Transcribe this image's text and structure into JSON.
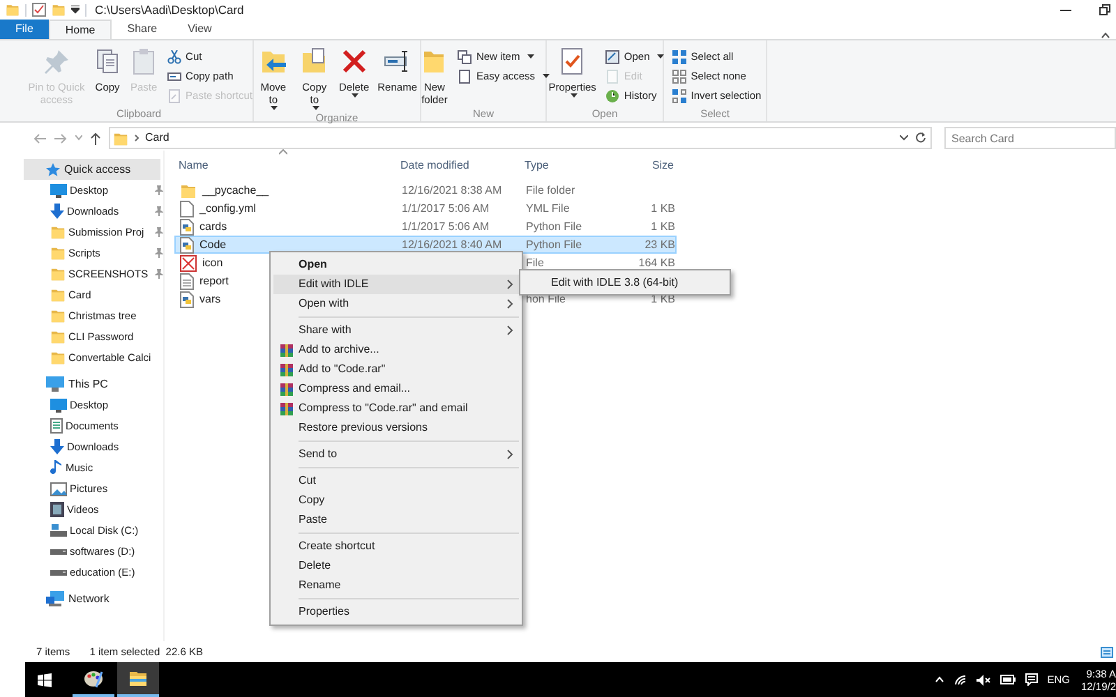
{
  "title_bar": {
    "path": "C:\\Users\\Aadi\\Desktop\\Card"
  },
  "tabs": [
    {
      "label": "File",
      "kind": "file",
      "selected": false
    },
    {
      "label": "Home",
      "kind": "tab",
      "selected": true
    },
    {
      "label": "Share",
      "kind": "tab",
      "selected": false
    },
    {
      "label": "View",
      "kind": "tab",
      "selected": false
    }
  ],
  "ribbon": [
    {
      "label": "Clipboard",
      "buttons": [
        {
          "label": "Pin to Quick access",
          "kind": "large",
          "disabled": true,
          "dropdown": false
        },
        {
          "label": "Copy",
          "kind": "large",
          "disabled": false,
          "dropdown": false
        },
        {
          "label": "Paste",
          "kind": "large",
          "disabled": true,
          "dropdown": false
        },
        {
          "label": "Cut",
          "kind": "small",
          "disabled": false,
          "dropdown": false
        },
        {
          "label": "Copy path",
          "kind": "small",
          "disabled": false,
          "dropdown": false
        },
        {
          "label": "Paste shortcut",
          "kind": "small",
          "disabled": true,
          "dropdown": false
        }
      ]
    },
    {
      "label": "Organize",
      "buttons": [
        {
          "label": "Move to",
          "kind": "large",
          "disabled": false,
          "dropdown": true
        },
        {
          "label": "Copy to",
          "kind": "large",
          "disabled": false,
          "dropdown": true
        },
        {
          "label": "Delete",
          "kind": "large",
          "disabled": false,
          "dropdown": true
        },
        {
          "label": "Rename",
          "kind": "large",
          "disabled": false,
          "dropdown": false
        }
      ]
    },
    {
      "label": "New",
      "buttons": [
        {
          "label": "New folder",
          "kind": "large",
          "disabled": false,
          "dropdown": false
        },
        {
          "label": "New item",
          "kind": "small",
          "disabled": false,
          "dropdown": true
        },
        {
          "label": "Easy access",
          "kind": "small",
          "disabled": false,
          "dropdown": true
        }
      ]
    },
    {
      "label": "Open",
      "buttons": [
        {
          "label": "Properties",
          "kind": "large",
          "disabled": false,
          "dropdown": true
        },
        {
          "label": "Open",
          "kind": "small",
          "disabled": false,
          "dropdown": true
        },
        {
          "label": "Edit",
          "kind": "small",
          "disabled": true,
          "dropdown": false
        },
        {
          "label": "History",
          "kind": "small",
          "disabled": false,
          "dropdown": false
        }
      ]
    },
    {
      "label": "Select",
      "buttons": [
        {
          "label": "Select all",
          "kind": "small",
          "disabled": false,
          "dropdown": false
        },
        {
          "label": "Select none",
          "kind": "small",
          "disabled": false,
          "dropdown": false
        },
        {
          "label": "Invert selection",
          "kind": "small",
          "disabled": false,
          "dropdown": false
        }
      ]
    }
  ],
  "address_bar": {
    "crumbs": [
      "Card"
    ],
    "search_placeholder": "Search Card"
  },
  "nav": [
    {
      "label": "Quick access",
      "kind": "star",
      "selected": true,
      "children": [
        {
          "label": "Desktop",
          "kind": "desktop",
          "pinned": true,
          "selected": false
        },
        {
          "label": "Downloads",
          "kind": "download",
          "pinned": true,
          "selected": false
        },
        {
          "label": "Submission Proj",
          "kind": "folder",
          "pinned": true,
          "selected": false
        },
        {
          "label": "Scripts",
          "kind": "folder",
          "pinned": true,
          "selected": false
        },
        {
          "label": "SCREENSHOTS",
          "kind": "folder",
          "pinned": true,
          "selected": false
        },
        {
          "label": "Card",
          "kind": "folder",
          "pinned": false,
          "selected": false
        },
        {
          "label": "Christmas tree",
          "kind": "folder",
          "pinned": false,
          "selected": false
        },
        {
          "label": "CLI Password",
          "kind": "folder",
          "pinned": false,
          "selected": false
        },
        {
          "label": "Convertable Calci",
          "kind": "folder",
          "pinned": false,
          "selected": false
        }
      ]
    },
    {
      "label": "This PC",
      "kind": "pc",
      "selected": false,
      "children": [
        {
          "label": "Desktop",
          "kind": "desktop",
          "pinned": false,
          "selected": false
        },
        {
          "label": "Documents",
          "kind": "documents",
          "pinned": false,
          "selected": false
        },
        {
          "label": "Downloads",
          "kind": "download",
          "pinned": false,
          "selected": false
        },
        {
          "label": "Music",
          "kind": "music",
          "pinned": false,
          "selected": false
        },
        {
          "label": "Pictures",
          "kind": "pictures",
          "pinned": false,
          "selected": false
        },
        {
          "label": "Videos",
          "kind": "videos",
          "pinned": false,
          "selected": false
        },
        {
          "label": "Local Disk (C:)",
          "kind": "system-drive",
          "pinned": false,
          "selected": false
        },
        {
          "label": "softwares (D:)",
          "kind": "drive",
          "pinned": false,
          "selected": false
        },
        {
          "label": "education (E:)",
          "kind": "drive",
          "pinned": false,
          "selected": false
        }
      ]
    },
    {
      "label": "Network",
      "kind": "network",
      "selected": false
    }
  ],
  "file_list": {
    "columns": [
      "Name",
      "Date modified",
      "Type",
      "Size"
    ],
    "rows": [
      {
        "name": "__pycache__",
        "date": "12/16/2021 8:38 AM",
        "type": "File folder",
        "size": "",
        "kind": "folder",
        "selected": false
      },
      {
        "name": "_config.yml",
        "date": "1/1/2017 5:06 AM",
        "type": "YML File",
        "size": "1 KB",
        "kind": "blank",
        "selected": false
      },
      {
        "name": "cards",
        "date": "1/1/2017 5:06 AM",
        "type": "Python File",
        "size": "1 KB",
        "kind": "python",
        "selected": false
      },
      {
        "name": "Code",
        "date": "12/16/2021 8:40 AM",
        "type": "Python File",
        "size": "23 KB",
        "kind": "python",
        "selected": true
      },
      {
        "name": "icon",
        "date": "",
        "type": "File",
        "size": "164 KB",
        "kind": "image",
        "selected": false
      },
      {
        "name": "report",
        "date": "",
        "type": "",
        "size": "",
        "kind": "text",
        "selected": false
      },
      {
        "name": "vars",
        "date": "",
        "type": "hon File",
        "size": "1 KB",
        "kind": "python",
        "selected": false
      }
    ]
  },
  "context_menu": {
    "items": [
      {
        "kind": "item",
        "label": "Open",
        "default": true,
        "selected": false,
        "submenu": false
      },
      {
        "kind": "item",
        "label": "Edit with IDLE",
        "default": false,
        "selected": true,
        "submenu": true
      },
      {
        "kind": "item",
        "label": "Open with",
        "default": false,
        "selected": false,
        "submenu": true
      },
      {
        "kind": "separator"
      },
      {
        "kind": "item",
        "label": "Share with",
        "default": false,
        "selected": false,
        "submenu": true
      },
      {
        "kind": "archive",
        "label": "Add to archive...",
        "default": false,
        "selected": false,
        "submenu": false
      },
      {
        "kind": "archive",
        "label": "Add to \"Code.rar\"",
        "default": false,
        "selected": false,
        "submenu": false
      },
      {
        "kind": "archive",
        "label": "Compress and email...",
        "default": false,
        "selected": false,
        "submenu": false
      },
      {
        "kind": "archive",
        "label": "Compress to \"Code.rar\" and email",
        "default": false,
        "selected": false,
        "submenu": false
      },
      {
        "kind": "item",
        "label": "Restore previous versions",
        "default": false,
        "selected": false,
        "submenu": false
      },
      {
        "kind": "separator"
      },
      {
        "kind": "item",
        "label": "Send to",
        "default": false,
        "selected": false,
        "submenu": true
      },
      {
        "kind": "separator"
      },
      {
        "kind": "item",
        "label": "Cut",
        "default": false,
        "selected": false,
        "submenu": false
      },
      {
        "kind": "item",
        "label": "Copy",
        "default": false,
        "selected": false,
        "submenu": false
      },
      {
        "kind": "item",
        "label": "Paste",
        "default": false,
        "selected": false,
        "submenu": false
      },
      {
        "kind": "separator"
      },
      {
        "kind": "item",
        "label": "Create shortcut",
        "default": false,
        "selected": false,
        "submenu": false
      },
      {
        "kind": "item",
        "label": "Delete",
        "default": false,
        "selected": false,
        "submenu": false
      },
      {
        "kind": "item",
        "label": "Rename",
        "default": false,
        "selected": false,
        "submenu": false
      },
      {
        "kind": "separator"
      },
      {
        "kind": "item",
        "label": "Properties",
        "default": false,
        "selected": false,
        "submenu": false
      }
    ],
    "submenu": [
      {
        "label": "Edit with IDLE 3.8 (64-bit)",
        "selected": false
      }
    ]
  },
  "status_bar": {
    "count": "7 items",
    "selection": "1 item selected  22.6 KB"
  },
  "taskbar": {
    "language": "ENG",
    "time": "9:38 A",
    "date": "12/19/2"
  }
}
